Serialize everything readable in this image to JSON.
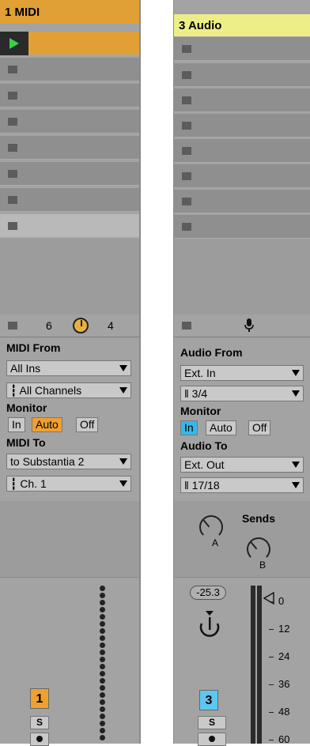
{
  "midi_track": {
    "title": "1 MIDI",
    "scene_row": {
      "value_left": "6",
      "value_right": "4"
    },
    "io": {
      "from_label": "MIDI From",
      "from_value": "All Ins",
      "channel_value": "┇ All Channels",
      "monitor_label": "Monitor",
      "monitor_options": [
        "In",
        "Auto",
        "Off"
      ],
      "monitor_selected": "Auto",
      "to_label": "MIDI To",
      "to_value": "to Substantia 2",
      "to_channel_value": "┇ Ch. 1"
    },
    "track_number": "1",
    "solo_label": "S",
    "accent": "#e0a035"
  },
  "audio_track": {
    "title": "3 Audio",
    "io": {
      "from_label": "Audio From",
      "from_value": "Ext. In",
      "channel_value": "‖ 3/4",
      "monitor_label": "Monitor",
      "monitor_options": [
        "In",
        "Auto",
        "Off"
      ],
      "monitor_selected": "In",
      "to_label": "Audio To",
      "to_value": "Ext. Out",
      "to_channel_value": "‖ 17/18"
    },
    "sends_label": "Sends",
    "send_a": "A",
    "send_b": "B",
    "volume": "-25.3",
    "meter_ticks": [
      "0",
      "12",
      "24",
      "36",
      "48",
      "60"
    ],
    "track_number": "3",
    "solo_label": "S",
    "accent": "#39b8e8",
    "mic_icon": "microphone-icon"
  }
}
